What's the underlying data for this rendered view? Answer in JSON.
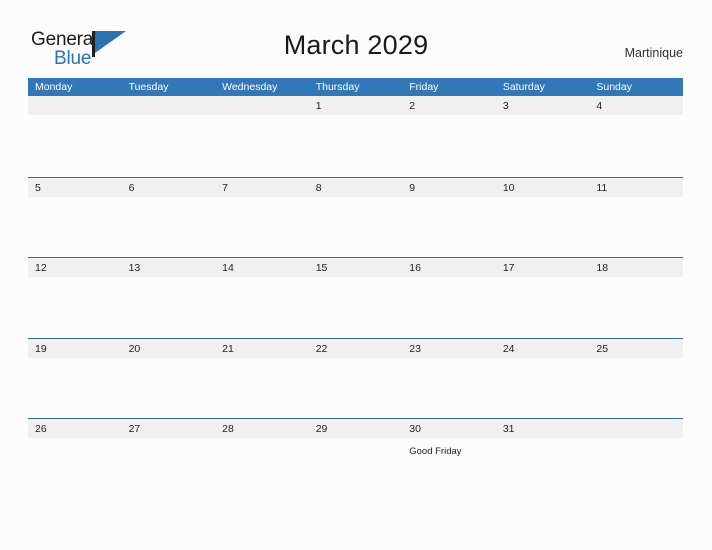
{
  "brand": {
    "word_one": "General",
    "word_two": "Blue",
    "flag_icon": "blue-triangle-flag",
    "accent_color": "#2b72b5"
  },
  "header": {
    "title": "March 2029",
    "location": "Martinique"
  },
  "calendar": {
    "header_bg": "#3277b8",
    "row_band_bg": "#f0f0f0",
    "row_divider_color": "#2d6ca8",
    "weekdays": [
      "Monday",
      "Tuesday",
      "Wednesday",
      "Thursday",
      "Friday",
      "Saturday",
      "Sunday"
    ],
    "weeks": [
      {
        "days": [
          {
            "num": "",
            "event": ""
          },
          {
            "num": "",
            "event": ""
          },
          {
            "num": "",
            "event": ""
          },
          {
            "num": "1",
            "event": ""
          },
          {
            "num": "2",
            "event": ""
          },
          {
            "num": "3",
            "event": ""
          },
          {
            "num": "4",
            "event": ""
          }
        ]
      },
      {
        "days": [
          {
            "num": "5",
            "event": ""
          },
          {
            "num": "6",
            "event": ""
          },
          {
            "num": "7",
            "event": ""
          },
          {
            "num": "8",
            "event": ""
          },
          {
            "num": "9",
            "event": ""
          },
          {
            "num": "10",
            "event": ""
          },
          {
            "num": "11",
            "event": ""
          }
        ]
      },
      {
        "days": [
          {
            "num": "12",
            "event": ""
          },
          {
            "num": "13",
            "event": ""
          },
          {
            "num": "14",
            "event": ""
          },
          {
            "num": "15",
            "event": ""
          },
          {
            "num": "16",
            "event": ""
          },
          {
            "num": "17",
            "event": ""
          },
          {
            "num": "18",
            "event": ""
          }
        ]
      },
      {
        "days": [
          {
            "num": "19",
            "event": ""
          },
          {
            "num": "20",
            "event": ""
          },
          {
            "num": "21",
            "event": ""
          },
          {
            "num": "22",
            "event": ""
          },
          {
            "num": "23",
            "event": ""
          },
          {
            "num": "24",
            "event": ""
          },
          {
            "num": "25",
            "event": ""
          }
        ]
      },
      {
        "days": [
          {
            "num": "26",
            "event": ""
          },
          {
            "num": "27",
            "event": ""
          },
          {
            "num": "28",
            "event": ""
          },
          {
            "num": "29",
            "event": ""
          },
          {
            "num": "30",
            "event": "Good Friday"
          },
          {
            "num": "31",
            "event": ""
          },
          {
            "num": "",
            "event": ""
          }
        ]
      }
    ]
  }
}
